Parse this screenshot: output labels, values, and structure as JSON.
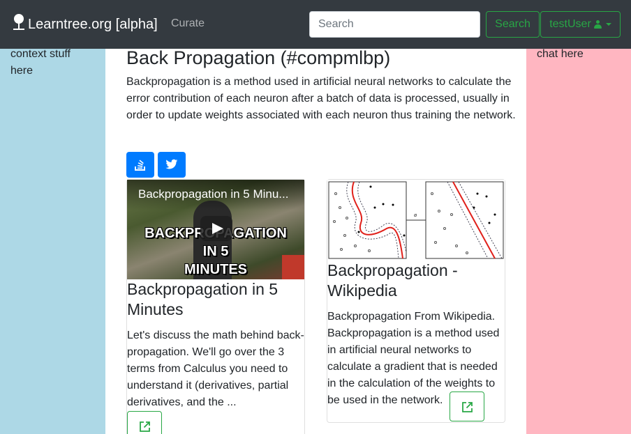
{
  "navbar": {
    "brand": "Learntree.org [alpha]",
    "curate_link": "Curate",
    "search_placeholder": "Search",
    "search_button": "Search",
    "user_button": "testUser"
  },
  "left_panel": {
    "text": "context stuff here"
  },
  "right_panel": {
    "text": "chat here"
  },
  "main": {
    "title": "Back Propagation (#compmlbp)",
    "description": "Backpropagation is a method used in artificial neural networks to calculate the error contribution of each neuron after a batch of data is processed, usually in order to update weights associated with each neuron thus training the network."
  },
  "cards": [
    {
      "video_overlay_title": "Backpropagation in 5 Minu...",
      "thumbnail_text_1": "BACKPROPAGATION",
      "thumbnail_text_2": "IN 5",
      "thumbnail_text_3": "MINUTES",
      "title": "Backpropagation in 5 Minutes",
      "description": "Let's discuss the math behind back-propagation. We'll go over the 3 terms from Calculus you need to understand it (derivatives, partial derivatives, and the ..."
    },
    {
      "title": "Backpropagation - Wikipedia",
      "description": "Backpropagation From Wikipedia. Backpropagation is a method used in artificial neural networks to calculate a gradient that is needed in the calculation of the weights to be used in the network."
    }
  ],
  "colors": {
    "navbar_bg": "#343a40",
    "success": "#28a745",
    "primary": "#007bff",
    "left_panel": "#add8e6",
    "right_panel": "#ffb6c1"
  },
  "icons": {
    "brand": "tree-icon",
    "user": "user-icon",
    "share_1": "stack-overflow-icon",
    "share_2": "twitter-icon",
    "external": "external-link-icon"
  }
}
